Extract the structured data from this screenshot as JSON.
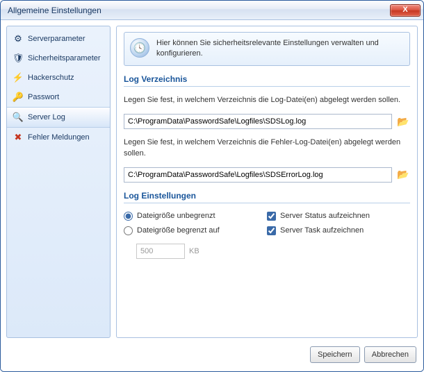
{
  "window": {
    "title": "Allgemeine Einstellungen"
  },
  "sidebar": {
    "items": [
      {
        "label": "Serverparameter",
        "icon": "⚙",
        "icon_color": "#3a6aa8"
      },
      {
        "label": "Sicherheitsparameter",
        "icon": "🛡",
        "icon_color": "#3a6aa8"
      },
      {
        "label": "Hackerschutz",
        "icon": "⚡",
        "icon_color": "#d9a020"
      },
      {
        "label": "Passwort",
        "icon": "🔑",
        "icon_color": "#d9a020"
      },
      {
        "label": "Server Log",
        "icon": "🔍",
        "icon_color": "#666",
        "selected": true
      },
      {
        "label": "Fehler Meldungen",
        "icon": "✖",
        "icon_color": "#c53722"
      }
    ]
  },
  "info": {
    "text": "Hier können Sie sicherheitsrelevante Einstellungen verwalten und konfigurieren."
  },
  "sections": {
    "log_dir": {
      "title": "Log Verzeichnis",
      "desc1": "Legen Sie fest, in welchem Verzeichnis die Log-Datei(en) abgelegt werden sollen.",
      "path1": "C:\\ProgramData\\PasswordSafe\\Logfiles\\SDSLog.log",
      "desc2": "Legen Sie fest, in welchem Verzeichnis die Fehler-Log-Datei(en) abgelegt werden sollen.",
      "path2": "C:\\ProgramData\\PasswordSafe\\Logfiles\\SDSErrorLog.log"
    },
    "log_settings": {
      "title": "Log Einstellungen",
      "radio_unlimited": "Dateigröße unbegrenzt",
      "radio_limited": "Dateigröße begrenzt auf",
      "size_value": "500",
      "size_unit": "KB",
      "check_status": "Server Status aufzeichnen",
      "check_task": "Server Task aufzeichnen"
    }
  },
  "buttons": {
    "save": "Speichern",
    "cancel": "Abbrechen",
    "browse_icon": "📂"
  }
}
